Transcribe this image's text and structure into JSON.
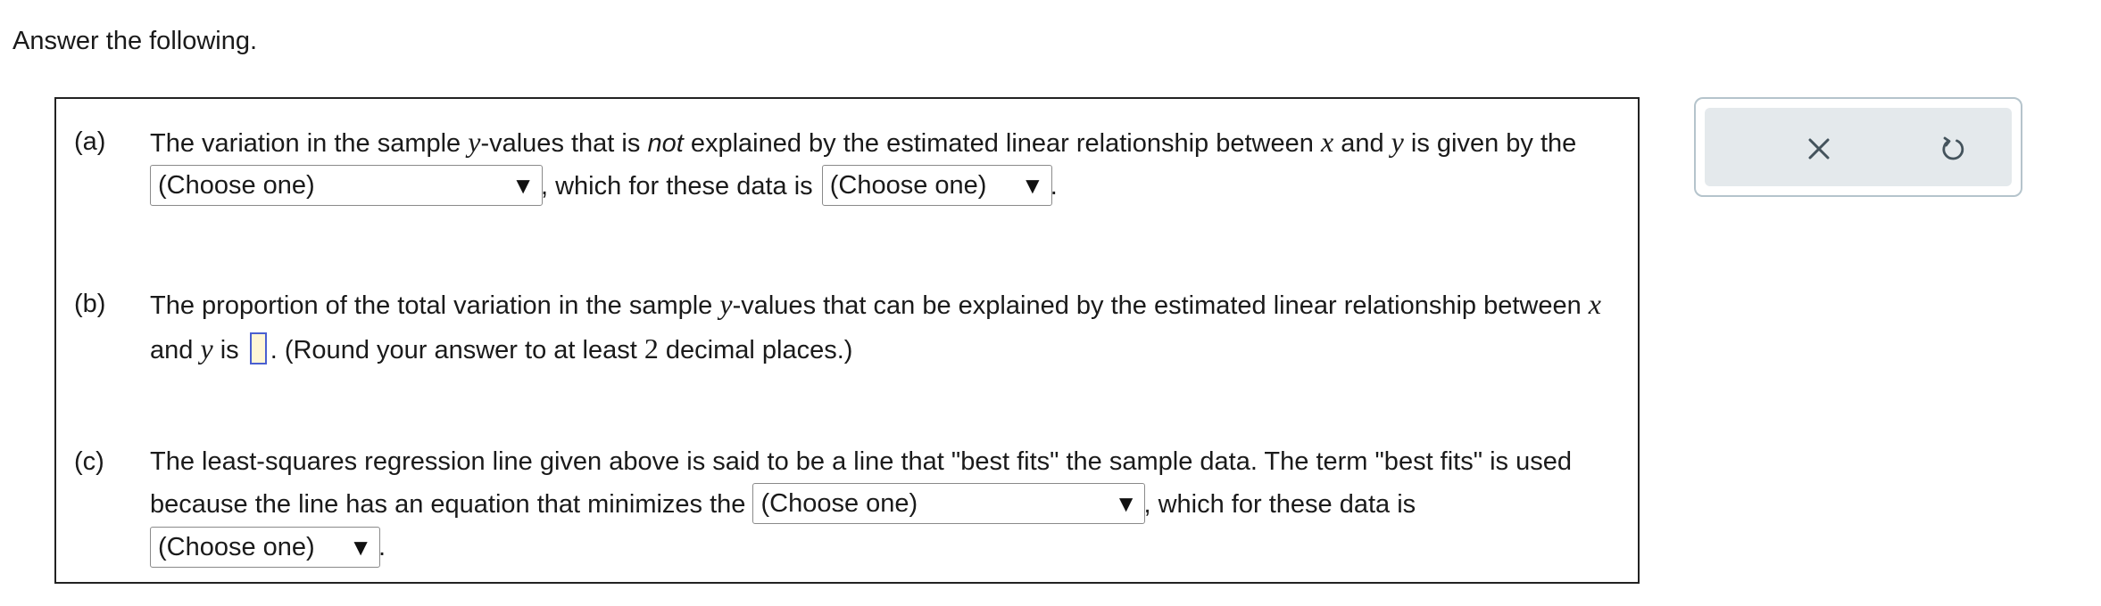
{
  "instruction": "Answer the following.",
  "parts": {
    "a": {
      "letter": "(a)",
      "text1": "The variation in the sample ",
      "var_y1": "y",
      "text2": "-values that is ",
      "emph": "not",
      "text3": " explained by the estimated linear relationship between ",
      "var_x": "x",
      "text4": " and ",
      "var_y2": "y",
      "text5": " is given by the ",
      "dropdown1": "(Choose one)",
      "text6": ", which for these data is ",
      "dropdown2": "(Choose one)",
      "text7": "."
    },
    "b": {
      "letter": "(b)",
      "text1": "The proportion of the total variation in the sample ",
      "var_y1": "y",
      "text2": "-values that can be explained by the estimated linear relationship between ",
      "var_x": "x",
      "text3": " and ",
      "var_y2": "y",
      "text4": " is ",
      "answer_value": "",
      "text5": ". (Round your answer to at least ",
      "num": "2",
      "text6": " decimal places.)"
    },
    "c": {
      "letter": "(c)",
      "text1": "The least-squares regression line given above is said to be a line that \"best fits\" the sample data. The term \"best fits\" is used because the line has an equation that minimizes the ",
      "dropdown1": "(Choose one)",
      "text2": ", which for these data is ",
      "dropdown2": "(Choose one)",
      "text3": "."
    }
  },
  "dropdown_arrow": "▼",
  "tools": {
    "clear_icon": "x-icon",
    "undo_icon": "undo-icon"
  },
  "colors": {
    "answer_box_border": "#4a5fd0",
    "answer_box_fill": "#fff6d6",
    "tools_background": "#e4e9ec",
    "tools_border": "#b5c4cc",
    "icon_color": "#44535c"
  }
}
